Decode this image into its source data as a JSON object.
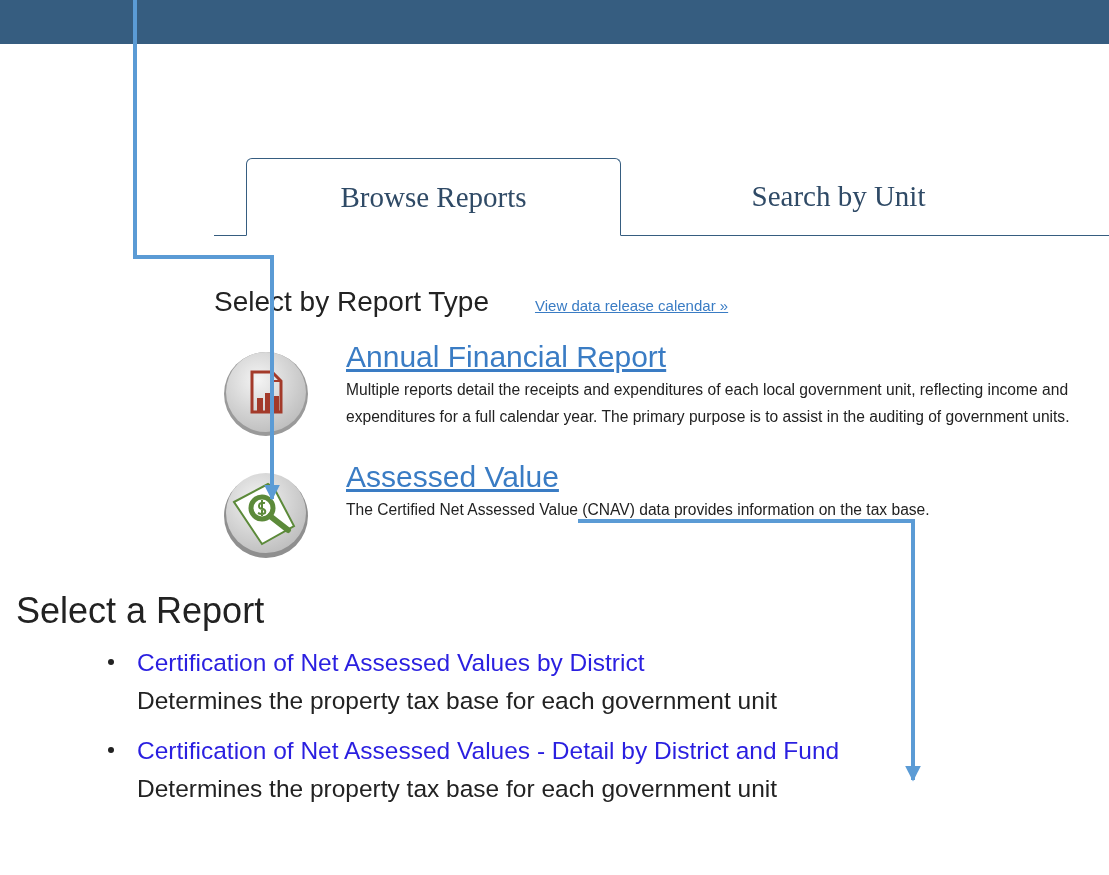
{
  "tabs": [
    {
      "label": "Browse Reports",
      "selected": true
    },
    {
      "label": "Search by Unit",
      "selected": false
    }
  ],
  "report_types": {
    "heading": "Select by Report Type",
    "calendar_link": "View data release calendar »",
    "items": [
      {
        "kind": "financial",
        "title": "Annual Financial Report",
        "description": "Multiple reports detail the receipts and expenditures of each local government unit, reflecting income and expenditures for a full calendar year. The primary purpose is to assist in the auditing of government units."
      },
      {
        "kind": "assessed",
        "title": "Assessed Value",
        "description": "The Certified Net Assessed Value (CNAV) data provides information on the tax base."
      }
    ]
  },
  "reports": {
    "heading": "Select a Report",
    "items": [
      {
        "title": "Certification of Net Assessed Values by District",
        "description": "Determines the property tax base for each government unit"
      },
      {
        "title": "Certification of Net Assessed Values - Detail by District and Fund",
        "description": "Determines the property tax base for each government unit"
      }
    ]
  }
}
